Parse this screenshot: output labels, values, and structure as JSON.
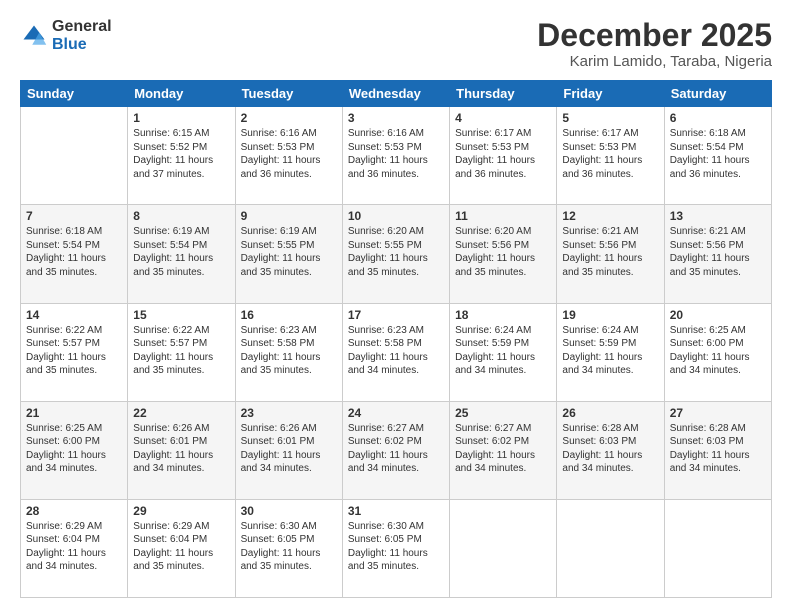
{
  "logo": {
    "general": "General",
    "blue": "Blue"
  },
  "header": {
    "title": "December 2025",
    "subtitle": "Karim Lamido, Taraba, Nigeria"
  },
  "weekdays": [
    "Sunday",
    "Monday",
    "Tuesday",
    "Wednesday",
    "Thursday",
    "Friday",
    "Saturday"
  ],
  "weeks": [
    [
      {
        "day": "",
        "sunrise": "",
        "sunset": "",
        "daylight": ""
      },
      {
        "day": "1",
        "sunrise": "Sunrise: 6:15 AM",
        "sunset": "Sunset: 5:52 PM",
        "daylight": "Daylight: 11 hours and 37 minutes."
      },
      {
        "day": "2",
        "sunrise": "Sunrise: 6:16 AM",
        "sunset": "Sunset: 5:53 PM",
        "daylight": "Daylight: 11 hours and 36 minutes."
      },
      {
        "day": "3",
        "sunrise": "Sunrise: 6:16 AM",
        "sunset": "Sunset: 5:53 PM",
        "daylight": "Daylight: 11 hours and 36 minutes."
      },
      {
        "day": "4",
        "sunrise": "Sunrise: 6:17 AM",
        "sunset": "Sunset: 5:53 PM",
        "daylight": "Daylight: 11 hours and 36 minutes."
      },
      {
        "day": "5",
        "sunrise": "Sunrise: 6:17 AM",
        "sunset": "Sunset: 5:53 PM",
        "daylight": "Daylight: 11 hours and 36 minutes."
      },
      {
        "day": "6",
        "sunrise": "Sunrise: 6:18 AM",
        "sunset": "Sunset: 5:54 PM",
        "daylight": "Daylight: 11 hours and 36 minutes."
      }
    ],
    [
      {
        "day": "7",
        "sunrise": "Sunrise: 6:18 AM",
        "sunset": "Sunset: 5:54 PM",
        "daylight": "Daylight: 11 hours and 35 minutes."
      },
      {
        "day": "8",
        "sunrise": "Sunrise: 6:19 AM",
        "sunset": "Sunset: 5:54 PM",
        "daylight": "Daylight: 11 hours and 35 minutes."
      },
      {
        "day": "9",
        "sunrise": "Sunrise: 6:19 AM",
        "sunset": "Sunset: 5:55 PM",
        "daylight": "Daylight: 11 hours and 35 minutes."
      },
      {
        "day": "10",
        "sunrise": "Sunrise: 6:20 AM",
        "sunset": "Sunset: 5:55 PM",
        "daylight": "Daylight: 11 hours and 35 minutes."
      },
      {
        "day": "11",
        "sunrise": "Sunrise: 6:20 AM",
        "sunset": "Sunset: 5:56 PM",
        "daylight": "Daylight: 11 hours and 35 minutes."
      },
      {
        "day": "12",
        "sunrise": "Sunrise: 6:21 AM",
        "sunset": "Sunset: 5:56 PM",
        "daylight": "Daylight: 11 hours and 35 minutes."
      },
      {
        "day": "13",
        "sunrise": "Sunrise: 6:21 AM",
        "sunset": "Sunset: 5:56 PM",
        "daylight": "Daylight: 11 hours and 35 minutes."
      }
    ],
    [
      {
        "day": "14",
        "sunrise": "Sunrise: 6:22 AM",
        "sunset": "Sunset: 5:57 PM",
        "daylight": "Daylight: 11 hours and 35 minutes."
      },
      {
        "day": "15",
        "sunrise": "Sunrise: 6:22 AM",
        "sunset": "Sunset: 5:57 PM",
        "daylight": "Daylight: 11 hours and 35 minutes."
      },
      {
        "day": "16",
        "sunrise": "Sunrise: 6:23 AM",
        "sunset": "Sunset: 5:58 PM",
        "daylight": "Daylight: 11 hours and 35 minutes."
      },
      {
        "day": "17",
        "sunrise": "Sunrise: 6:23 AM",
        "sunset": "Sunset: 5:58 PM",
        "daylight": "Daylight: 11 hours and 34 minutes."
      },
      {
        "day": "18",
        "sunrise": "Sunrise: 6:24 AM",
        "sunset": "Sunset: 5:59 PM",
        "daylight": "Daylight: 11 hours and 34 minutes."
      },
      {
        "day": "19",
        "sunrise": "Sunrise: 6:24 AM",
        "sunset": "Sunset: 5:59 PM",
        "daylight": "Daylight: 11 hours and 34 minutes."
      },
      {
        "day": "20",
        "sunrise": "Sunrise: 6:25 AM",
        "sunset": "Sunset: 6:00 PM",
        "daylight": "Daylight: 11 hours and 34 minutes."
      }
    ],
    [
      {
        "day": "21",
        "sunrise": "Sunrise: 6:25 AM",
        "sunset": "Sunset: 6:00 PM",
        "daylight": "Daylight: 11 hours and 34 minutes."
      },
      {
        "day": "22",
        "sunrise": "Sunrise: 6:26 AM",
        "sunset": "Sunset: 6:01 PM",
        "daylight": "Daylight: 11 hours and 34 minutes."
      },
      {
        "day": "23",
        "sunrise": "Sunrise: 6:26 AM",
        "sunset": "Sunset: 6:01 PM",
        "daylight": "Daylight: 11 hours and 34 minutes."
      },
      {
        "day": "24",
        "sunrise": "Sunrise: 6:27 AM",
        "sunset": "Sunset: 6:02 PM",
        "daylight": "Daylight: 11 hours and 34 minutes."
      },
      {
        "day": "25",
        "sunrise": "Sunrise: 6:27 AM",
        "sunset": "Sunset: 6:02 PM",
        "daylight": "Daylight: 11 hours and 34 minutes."
      },
      {
        "day": "26",
        "sunrise": "Sunrise: 6:28 AM",
        "sunset": "Sunset: 6:03 PM",
        "daylight": "Daylight: 11 hours and 34 minutes."
      },
      {
        "day": "27",
        "sunrise": "Sunrise: 6:28 AM",
        "sunset": "Sunset: 6:03 PM",
        "daylight": "Daylight: 11 hours and 34 minutes."
      }
    ],
    [
      {
        "day": "28",
        "sunrise": "Sunrise: 6:29 AM",
        "sunset": "Sunset: 6:04 PM",
        "daylight": "Daylight: 11 hours and 34 minutes."
      },
      {
        "day": "29",
        "sunrise": "Sunrise: 6:29 AM",
        "sunset": "Sunset: 6:04 PM",
        "daylight": "Daylight: 11 hours and 35 minutes."
      },
      {
        "day": "30",
        "sunrise": "Sunrise: 6:30 AM",
        "sunset": "Sunset: 6:05 PM",
        "daylight": "Daylight: 11 hours and 35 minutes."
      },
      {
        "day": "31",
        "sunrise": "Sunrise: 6:30 AM",
        "sunset": "Sunset: 6:05 PM",
        "daylight": "Daylight: 11 hours and 35 minutes."
      },
      {
        "day": "",
        "sunrise": "",
        "sunset": "",
        "daylight": ""
      },
      {
        "day": "",
        "sunrise": "",
        "sunset": "",
        "daylight": ""
      },
      {
        "day": "",
        "sunrise": "",
        "sunset": "",
        "daylight": ""
      }
    ]
  ]
}
